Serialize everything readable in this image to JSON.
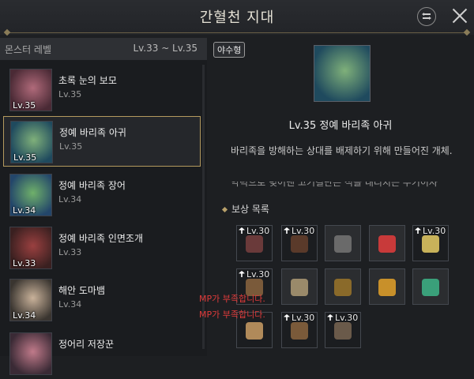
{
  "window": {
    "title": "간혈천 지대",
    "settings_icon": "filter-icon",
    "close_icon": "close-icon"
  },
  "level_filter": {
    "label": "몬스터 레벨",
    "range": "Lv.33 ~ Lv.35"
  },
  "monsters": [
    {
      "name": "초록 눈의 보모",
      "level": "Lv.35",
      "badge": "Lv.35",
      "colors": [
        "#4a2a35",
        "#b06a7a"
      ]
    },
    {
      "name": "정예 바리족 아귀",
      "level": "Lv.35",
      "badge": "Lv.35",
      "colors": [
        "#1f4a5e",
        "#7fb07a"
      ]
    },
    {
      "name": "정예 바리족 장어",
      "level": "Lv.34",
      "badge": "Lv.34",
      "colors": [
        "#23466a",
        "#6fb06a"
      ]
    },
    {
      "name": "정예 바리족 인면조개",
      "level": "Lv.33",
      "badge": "Lv.33",
      "colors": [
        "#3a2020",
        "#9a4040"
      ]
    },
    {
      "name": "해안 도마뱀",
      "level": "Lv.34",
      "badge": "Lv.34",
      "colors": [
        "#3a3530",
        "#c9b29a"
      ]
    },
    {
      "name": "정어리 저장꾼",
      "level": "",
      "badge": "",
      "colors": [
        "#3a2a35",
        "#c07a8a"
      ]
    }
  ],
  "detail": {
    "tag": "야수형",
    "level": "Lv.35",
    "name": "정예 바리족 아귀",
    "description": "바리족을 방해하는 상대를 배제하기 위해 만들어진 개체.",
    "description_next": "악력으로 빚어낸 고기결단은 적을 내리치는 무기이자"
  },
  "rewards": {
    "title": "보상 목록",
    "items": [
      {
        "lv": "Lv.30",
        "icon": "claw-glove-icon"
      },
      {
        "lv": "Lv.30",
        "icon": "boots-icon"
      },
      {
        "lv": "",
        "icon": "armor-icon"
      },
      {
        "lv": "",
        "icon": "red-card-icon"
      },
      {
        "lv": "Lv.30",
        "icon": "shield-icon"
      },
      {
        "lv": "Lv.30",
        "icon": "crossbow-icon"
      },
      {
        "lv": "",
        "icon": "stick-icon"
      },
      {
        "lv": "",
        "icon": "treasure-chest-icon"
      },
      {
        "lv": "",
        "icon": "orange-box-icon"
      },
      {
        "lv": "",
        "icon": "green-box-icon"
      },
      {
        "lv": "",
        "icon": "scroll-icon"
      },
      {
        "lv": "Lv.30",
        "icon": "cloak-icon"
      },
      {
        "lv": "Lv.30",
        "icon": "bow-icon"
      }
    ]
  },
  "mp_warning": "MP가 부족합니다."
}
